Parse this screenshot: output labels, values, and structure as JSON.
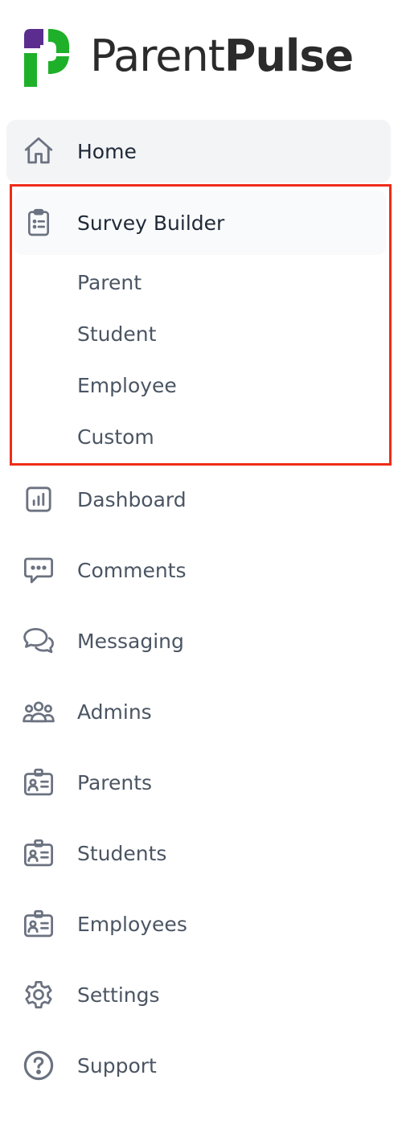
{
  "brand": {
    "name_light": "Parent",
    "name_bold": "Pulse",
    "colors": {
      "purple": "#5b2d8e",
      "green": "#1fb02a",
      "text": "#2b2b2b"
    }
  },
  "nav": {
    "home": {
      "label": "Home",
      "icon": "home-icon"
    },
    "survey_builder": {
      "label": "Survey Builder",
      "icon": "clipboard-list-icon",
      "children": [
        "Parent",
        "Student",
        "Employee",
        "Custom"
      ]
    },
    "items": [
      {
        "label": "Dashboard",
        "icon": "bar-chart-icon"
      },
      {
        "label": "Comments",
        "icon": "chat-bubble-icon"
      },
      {
        "label": "Messaging",
        "icon": "conversation-icon"
      },
      {
        "label": "Admins",
        "icon": "user-group-icon"
      },
      {
        "label": "Parents",
        "icon": "id-badge-icon"
      },
      {
        "label": "Students",
        "icon": "id-badge-icon"
      },
      {
        "label": "Employees",
        "icon": "id-badge-icon"
      },
      {
        "label": "Settings",
        "icon": "gear-icon"
      },
      {
        "label": "Support",
        "icon": "question-circle-icon"
      }
    ]
  },
  "colors": {
    "active_bg": "#f3f4f6",
    "highlight_border": "#ee2c18",
    "icon": "#6b7280",
    "text": "#4b5563"
  }
}
